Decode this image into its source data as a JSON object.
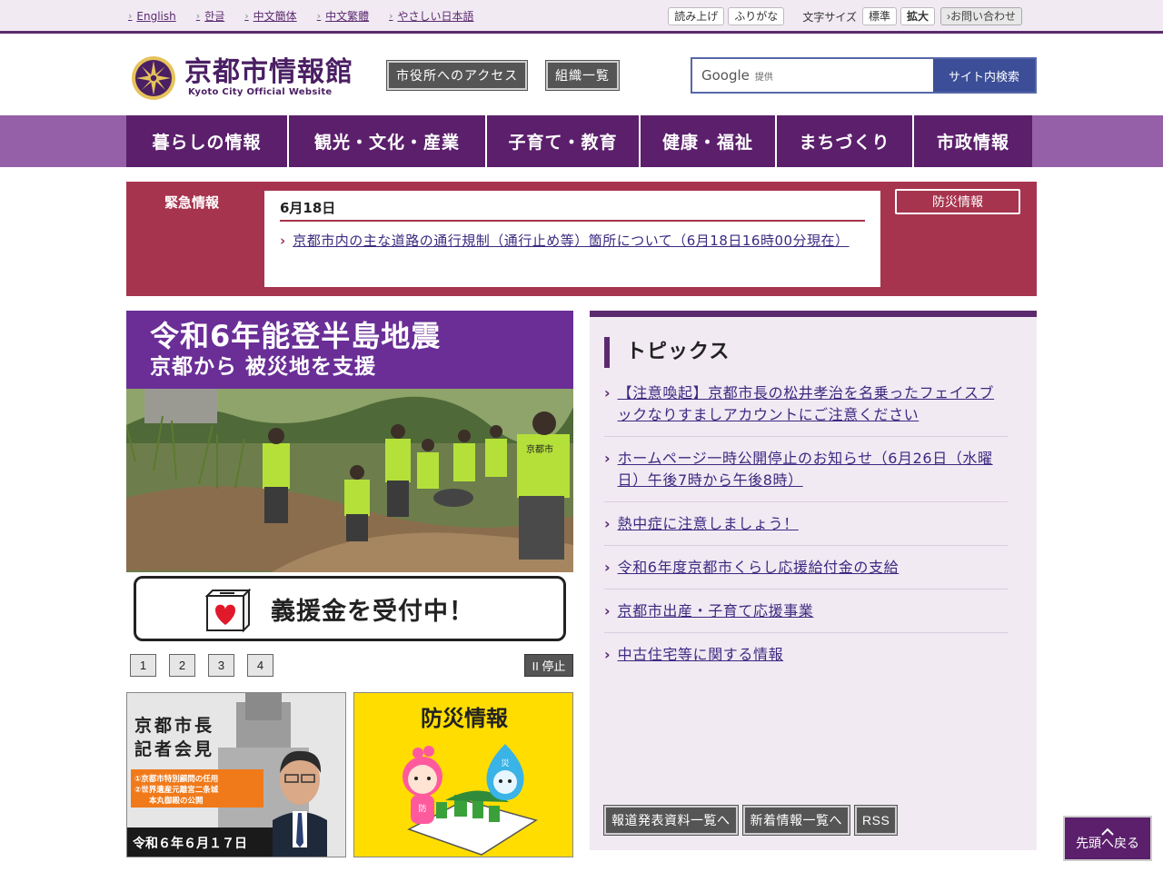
{
  "languages": [
    "English",
    "한글",
    "中文簡体",
    "中文繁體",
    "やさしい日本語"
  ],
  "utility": {
    "read_aloud": "読み上げ",
    "furigana": "ふりがな",
    "font_size_label": "文字サイズ",
    "font_standard": "標準",
    "font_large": "拡大",
    "inquiry": "お問い合わせ"
  },
  "header": {
    "logo_main": "京都市情報館",
    "logo_sub": "Kyoto City Official Website",
    "access_button": "市役所へのアクセス",
    "org_button": "組織一覧",
    "search_brand": "Google",
    "search_brand_suffix": "提供",
    "search_button": "サイト内検索"
  },
  "nav": [
    "暮らしの情報",
    "観光・文化・産業",
    "子育て・教育",
    "健康・福祉",
    "まちづくり",
    "市政情報"
  ],
  "emergency": {
    "label": "緊急情報",
    "date": "6月18日",
    "link": "京都市内の主な道路の通行規制（通行止め等）箇所について（6月18日16時00分現在）",
    "bousai_button": "防災情報"
  },
  "slide": {
    "title1": "令和6年能登半島地震",
    "title2": "京都から 被災地を支援",
    "cta": "義援金を受付中！",
    "vest_text": "京都市",
    "pages": [
      "1",
      "2",
      "3",
      "4"
    ],
    "pause": "II 停止"
  },
  "banners": {
    "mayor_title1": "京都市長",
    "mayor_title2": "記者会見",
    "mayor_item1": "①京都市特別顧問の任用",
    "mayor_item2": "②世界遺産元離宮二条城",
    "mayor_item3": "本丸御殿の公開",
    "mayor_date": "令和６年６月１７日",
    "bousai_title": "防災情報",
    "char_left": "防",
    "char_right": "災"
  },
  "topics": {
    "title": "トピックス",
    "items": [
      "【注意喚起】京都市長の松井孝治を名乗ったフェイスブックなりすましアカウントにご注意ください",
      "ホームページ一時公開停止のお知らせ（6月26日（水曜日）午後7時から午後8時）",
      "熱中症に注意しましょう！",
      "令和6年度京都市くらし応援給付金の支給",
      "京都市出産・子育て応援事業",
      "中古住宅等に関する情報"
    ],
    "buttons": [
      "報道発表資料一覧へ",
      "新着情報一覧へ",
      "RSS"
    ]
  },
  "back_to_top": "先頭へ戻る",
  "colors": {
    "primary_purple": "#5b1f6b",
    "emergency_red": "#a7344e",
    "search_blue": "#3c4e97",
    "bousai_yellow": "#ffdd00"
  }
}
